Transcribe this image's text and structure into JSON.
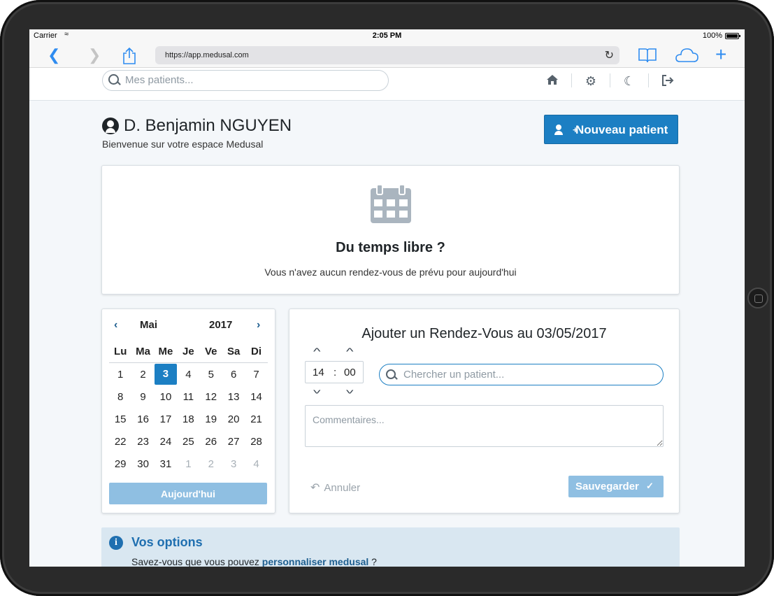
{
  "status": {
    "carrier": "Carrier",
    "time": "2:05 PM",
    "battery": "100%"
  },
  "browser": {
    "url": "https://app.medusal.com"
  },
  "header": {
    "search_placeholder": "Mes patients..."
  },
  "user": {
    "name": "D. Benjamin NGUYEN",
    "welcome": "Bienvenue sur votre espace Medusal"
  },
  "actions": {
    "new_patient": "Nouveau patient"
  },
  "free_time": {
    "title": "Du temps libre ?",
    "message": "Vous n'avez aucun rendez-vous de prévu pour aujourd'hui"
  },
  "calendar": {
    "month": "Mai",
    "year": "2017",
    "weekdays": [
      "Lu",
      "Ma",
      "Me",
      "Je",
      "Ve",
      "Sa",
      "Di"
    ],
    "weeks": [
      [
        "1",
        "2",
        "3",
        "4",
        "5",
        "6",
        "7"
      ],
      [
        "8",
        "9",
        "10",
        "11",
        "12",
        "13",
        "14"
      ],
      [
        "15",
        "16",
        "17",
        "18",
        "19",
        "20",
        "21"
      ],
      [
        "22",
        "23",
        "24",
        "25",
        "26",
        "27",
        "28"
      ],
      [
        "29",
        "30",
        "31",
        "1",
        "2",
        "3",
        "4"
      ]
    ],
    "selected_day": "3",
    "today_label": "Aujourd'hui"
  },
  "appointment": {
    "title": "Ajouter un Rendez-Vous au 03/05/2017",
    "hour": "14",
    "minute": "00",
    "separator": ":",
    "patient_search_placeholder": "Chercher un patient...",
    "comments_placeholder": "Commentaires...",
    "cancel_label": "Annuler",
    "save_label": "Sauvegarder"
  },
  "options": {
    "title": "Vos options",
    "text_before": "Savez-vous que vous pouvez ",
    "link": "personnaliser medusal",
    "text_after": " ?"
  },
  "colors": {
    "primary": "#1c7fc3",
    "primary_light": "#8fbfe2",
    "info_bg": "#d9e7f1",
    "page_bg": "#f4f7fa"
  }
}
